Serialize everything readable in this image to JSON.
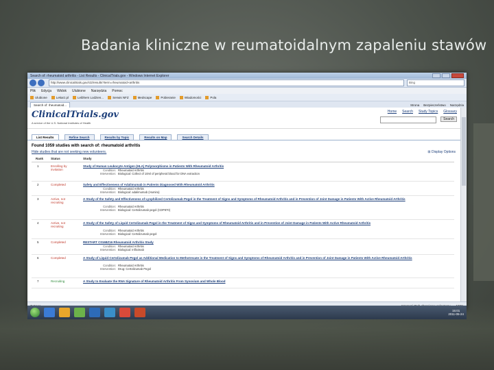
{
  "slide": {
    "title": "Badania kliniczne w reumatoidalnym zapaleniu stawów"
  },
  "browser": {
    "window_title": "Search of: rheumatoid arthritis - List Results - ClinicalTrials.gov - Windows Internet Explorer",
    "address": "http://www.clinicaltrials.gov/ct2/results?term=rheumatoid+arthritis",
    "search_placeholder": "Bing",
    "menu": [
      "Plik",
      "Edycja",
      "Widok",
      "Ulubione",
      "Narzędzia",
      "Pomoc"
    ],
    "favorites": [
      "Ulubione",
      "Lekarz.pl",
      "Leibhem Lodzien...",
      "Serwis NFZ",
      "Medscape",
      "Pobieranie",
      "Wiadomości",
      "Pola"
    ],
    "tab_label": "Search of: rheumatoid...",
    "toolbar_right": [
      "Strona",
      "Bezpieczeństwo",
      "Narzędzia"
    ],
    "status_left": "Gotowe",
    "status_right": "Internet | Tryb chroniony: wyłączony",
    "zoom": "100%"
  },
  "page": {
    "logo": "ClinicalTrials.gov",
    "tagline": "A service of the U.S. National Institutes of Health",
    "top_links": [
      "Home",
      "Search",
      "Study Topics",
      "Glossary"
    ],
    "search_button": "Search",
    "tabs": [
      "List Results",
      "Refine Search",
      "Results by Topic",
      "Results on Map",
      "Search Details"
    ],
    "found_text": "Found 1059 studies with search of: rheumatoid arthritis",
    "hide_link": "Hide studies that are not seeking new volunteers.",
    "display_options": "Display Options",
    "columns": [
      "Rank",
      "Status",
      "Study"
    ],
    "rows": [
      {
        "rank": "1",
        "status": "Enrolling by invitation",
        "status_color": "#c0392b",
        "study": "Study of Human Leukocyte Antigen (HLA) Polymorphisms in Patients With Rheumatoid Arthritis",
        "condition": "Rheumatoid Arthritis",
        "intervention": "Biological: Collect of 10ml of peripheral blood for DNA extraction"
      },
      {
        "rank": "2",
        "status": "Completed",
        "status_color": "#c0392b",
        "study": "Safety and Effectiveness of Adalimumab in Patients Diagnosed With Rheumatoid Arthritis",
        "condition": "Rheumatoid Arthritis",
        "intervention": "Biological: adalimumab (Humira)"
      },
      {
        "rank": "3",
        "status": "Active, not recruiting",
        "status_color": "#c0392b",
        "study": "A Study of the Safety and Effectiveness of Lyophilized Certolizumab Pegol in the Treatment of Signs and Symptoms of Rheumatoid Arthritis and in Prevention of Joint Damage in Patients With Active Rheumatoid Arthritis",
        "condition": "Rheumatoid Arthritis",
        "intervention": "Biological: Certolizumab pegol (CDP870)"
      },
      {
        "rank": "4",
        "status": "Active, not recruiting",
        "status_color": "#c0392b",
        "study": "A Study of the Safety of Liquid Certolizumab Pegol in the Treatment of Signs and Symptoms of Rheumatoid Arthritis and in Prevention of Joint Damage in Patients With Active Rheumatoid Arthritis",
        "condition": "Rheumatoid Arthritis",
        "intervention": "Biological: Certolizumab pegol"
      },
      {
        "rank": "5",
        "status": "Completed",
        "status_color": "#c0392b",
        "study": "RESTART C0168Z16 Rheumatoid Arthritis Study",
        "condition": "Rheumatoid Arthritis",
        "intervention": "Biological: Infliximab"
      },
      {
        "rank": "6",
        "status": "Completed",
        "status_color": "#c0392b",
        "study": "A Study of Liquid Certolizumab Pegol as Additional Medication to Methotrexate in the Treatment of Signs and Symptoms of Rheumatoid Arthritis and in Prevention of Joint Damage in Patients With Active Rheumatoid Arthritis",
        "condition": "Rheumatoid Arthritis",
        "intervention": "Drug: Certolizumab Pegol"
      },
      {
        "rank": "7",
        "status": "Recruiting",
        "status_color": "#2e8b3a",
        "study": "A Study to Evaluate the RNA Signature of Rheumatoid Arthritis From Synovium and Whole Blood",
        "condition": "",
        "intervention": ""
      }
    ]
  },
  "taskbar": {
    "time": "15:01",
    "date": "2011-05-24"
  }
}
